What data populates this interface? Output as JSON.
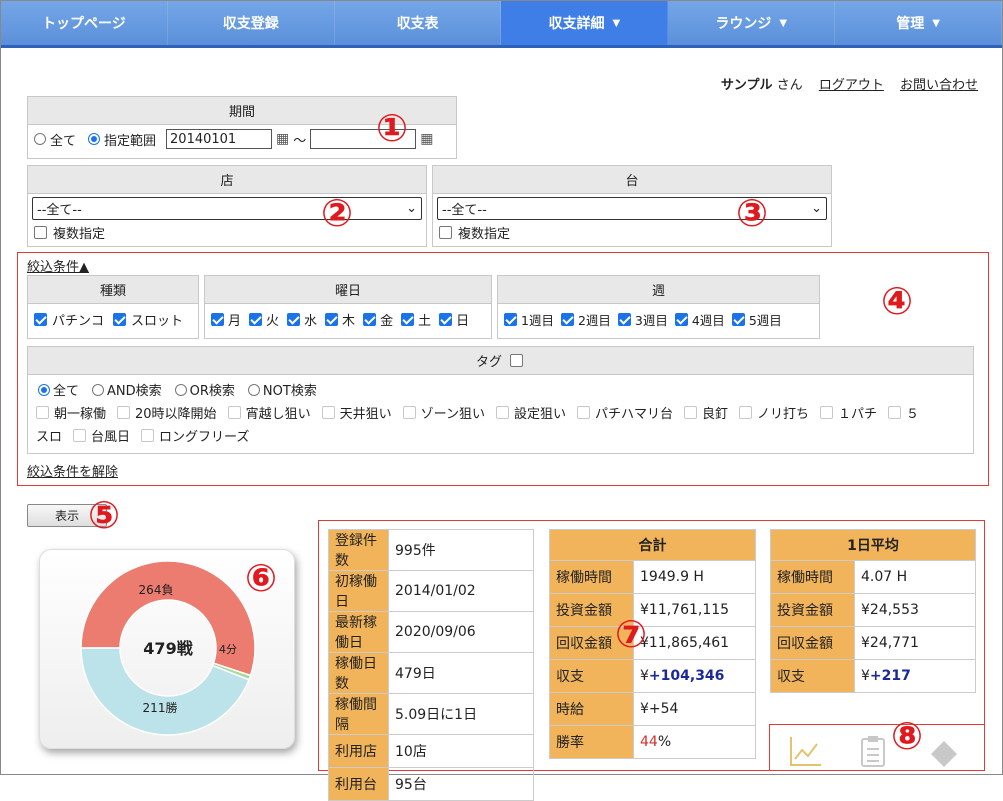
{
  "nav": [
    {
      "label": "トップページ",
      "active": false,
      "dropdown": false
    },
    {
      "label": "収支登録",
      "active": false,
      "dropdown": false
    },
    {
      "label": "収支表",
      "active": false,
      "dropdown": false
    },
    {
      "label": "収支詳細",
      "active": true,
      "dropdown": true
    },
    {
      "label": "ラウンジ",
      "active": false,
      "dropdown": true
    },
    {
      "label": "管理",
      "active": false,
      "dropdown": true
    }
  ],
  "user": {
    "name": "サンプル",
    "suffix": "さん",
    "logout": "ログアウト",
    "contact": "お問い合わせ"
  },
  "period": {
    "title": "期間",
    "opt_all": "全て",
    "opt_range": "指定範囲",
    "from": "20140101",
    "tilde": "～",
    "to": ""
  },
  "shop": {
    "title": "店",
    "selected": "--全て--",
    "multi": "複数指定"
  },
  "machine": {
    "title": "台",
    "selected": "--全て--",
    "multi": "複数指定"
  },
  "filter": {
    "toggle": "絞込条件▲",
    "kind": {
      "title": "種類",
      "items": [
        "パチンコ",
        "スロット"
      ]
    },
    "weekday": {
      "title": "曜日",
      "items": [
        "月",
        "火",
        "水",
        "木",
        "金",
        "土",
        "日"
      ]
    },
    "week": {
      "title": "週",
      "items": [
        "1週目",
        "2週目",
        "3週目",
        "4週目",
        "5週目"
      ]
    },
    "tag": {
      "title": "タグ",
      "modes": [
        "全て",
        "AND検索",
        "OR検索",
        "NOT検索"
      ],
      "tags_line1": [
        "朝一稼働",
        "20時以降開始",
        "宵越し狙い",
        "天井狙い",
        "ゾーン狙い",
        "設定狙い",
        "パチハマリ台",
        "良釘",
        "ノリ打ち",
        "１パチ",
        "５"
      ],
      "tags_line2_first": "スロ",
      "tags_line2": [
        "台風日",
        "ロングフリーズ"
      ]
    },
    "clear": "絞込条件を解除"
  },
  "show_button": "表示",
  "donut": {
    "center": "479戦",
    "lose_label": "264負",
    "win_label": "211勝",
    "draw_label": "4分",
    "lose": 264,
    "win": 211,
    "draw": 4
  },
  "summary": {
    "rows": [
      {
        "k": "登録件数",
        "v": "995件"
      },
      {
        "k": "初稼働日",
        "v": "2014/01/02"
      },
      {
        "k": "最新稼働日",
        "v": "2020/09/06"
      },
      {
        "k": "稼働日数",
        "v": "479日"
      },
      {
        "k": "稼働間隔",
        "v": "5.09日に1日"
      },
      {
        "k": "利用店",
        "v": "10店"
      },
      {
        "k": "利用台",
        "v": "95台"
      }
    ]
  },
  "total": {
    "title": "合計",
    "rows": [
      {
        "k": "稼働時間",
        "v": "1949.9 H"
      },
      {
        "k": "投資金額",
        "v": "¥11,761,115"
      },
      {
        "k": "回収金額",
        "v": "¥11,865,461"
      },
      {
        "k": "収支",
        "v_prefix": "¥",
        "v": "+104,346"
      },
      {
        "k": "時給",
        "v": "¥+54"
      },
      {
        "k": "勝率",
        "v_num": "44",
        "v_unit": "%"
      }
    ]
  },
  "daily": {
    "title": "1日平均",
    "rows": [
      {
        "k": "稼働時間",
        "v": "4.07 H"
      },
      {
        "k": "投資金額",
        "v": "¥24,553"
      },
      {
        "k": "回収金額",
        "v": "¥24,771"
      },
      {
        "k": "収支",
        "v_prefix": "¥",
        "v": "+217"
      }
    ]
  },
  "markers": [
    "①",
    "②",
    "③",
    "④",
    "⑤",
    "⑥",
    "⑦",
    "⑧"
  ],
  "colors": {
    "nav": "#5b90da",
    "nav_active": "#3f7ee6",
    "accent": "#1a73e8",
    "table_key": "#f1b45a",
    "marker": "#e0191f"
  }
}
